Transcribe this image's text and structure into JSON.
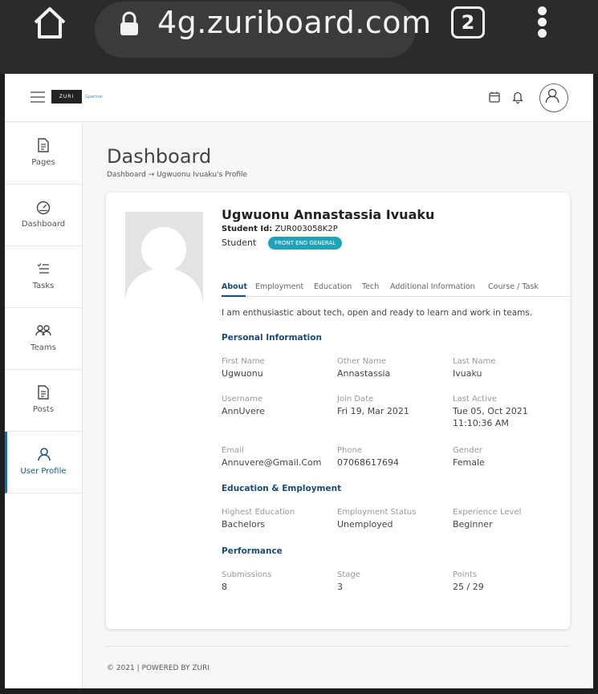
{
  "browser": {
    "url": "4g.zuriboard.com",
    "tab_count": "2"
  },
  "header": {
    "logo_text": "ZURI",
    "partner_text": "Gpartner"
  },
  "sidebar": {
    "items": [
      {
        "label": "Pages"
      },
      {
        "label": "Dashboard"
      },
      {
        "label": "Tasks"
      },
      {
        "label": "Teams"
      },
      {
        "label": "Posts"
      },
      {
        "label": "User Profile"
      }
    ]
  },
  "main": {
    "title": "Dashboard",
    "breadcrumb": "Dashboard → Ugwuonu Ivuaku's Profile"
  },
  "profile": {
    "name": "Ugwuonu Annastassia Ivuaku",
    "student_id_label": "Student Id:",
    "student_id": "ZUR003058K2P",
    "role": "Student",
    "track": "FRONT END GENERAL",
    "tabs": [
      "About",
      "Employment",
      "Education",
      "Tech",
      "Additional Information",
      "Course / Task"
    ],
    "about": "I am enthusiastic about tech, open and ready to learn and work in teams.",
    "sections": {
      "personal": "Personal Information",
      "education": "Education & Employment",
      "performance": "Performance"
    },
    "personal_fields": [
      {
        "label": "First Name",
        "value": "Ugwuonu"
      },
      {
        "label": "Other Name",
        "value": "Annastassia"
      },
      {
        "label": "Last Name",
        "value": "Ivuaku"
      },
      {
        "label": "Username",
        "value": "AnnUvere"
      },
      {
        "label": "Join Date",
        "value": "Fri 19, Mar 2021"
      },
      {
        "label": "Last Active",
        "value": "Tue 05, Oct 2021 11:10:36 AM"
      },
      {
        "label": "Email",
        "value": "Annuvere@Gmail.Com"
      },
      {
        "label": "Phone",
        "value": "07068617694"
      },
      {
        "label": "Gender",
        "value": "Female"
      }
    ],
    "education_fields": [
      {
        "label": "Highest Education",
        "value": "Bachelors"
      },
      {
        "label": "Employment Status",
        "value": "Unemployed"
      },
      {
        "label": "Experience Level",
        "value": "Beginner"
      }
    ],
    "performance_fields": [
      {
        "label": "Submissions",
        "value": "8"
      },
      {
        "label": "Stage",
        "value": "3"
      },
      {
        "label": "Points",
        "value": "25 / 29"
      }
    ]
  },
  "footer": {
    "text": "© 2021 | POWERED BY ZURI"
  }
}
